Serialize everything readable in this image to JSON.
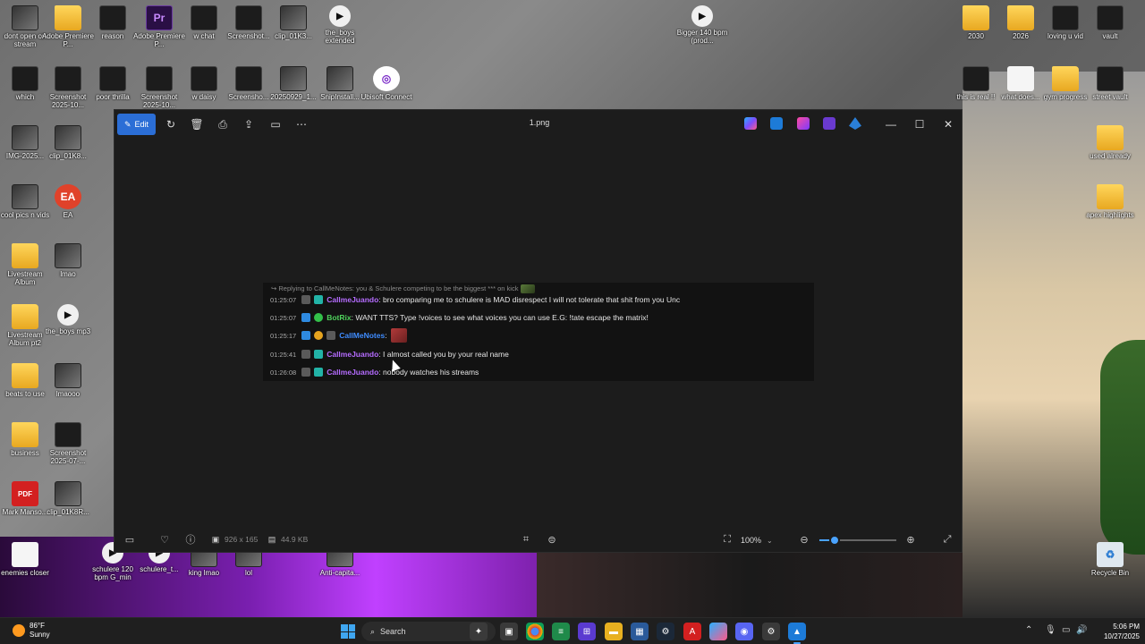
{
  "desktop": {
    "icons": [
      {
        "label": "dont open on stream",
        "type": "thumb",
        "glyph": ""
      },
      {
        "label": "Adobe Premiere P...",
        "type": "folder",
        "glyph": ""
      },
      {
        "label": "reason",
        "type": "dark",
        "glyph": ""
      },
      {
        "label": "Adobe Premiere P...",
        "type": "purple",
        "glyph": "Pr"
      },
      {
        "label": "w chat",
        "type": "dark",
        "glyph": ""
      },
      {
        "label": "Screenshot...",
        "type": "dark",
        "glyph": ""
      },
      {
        "label": "clip_01K3...",
        "type": "thumb",
        "glyph": ""
      },
      {
        "label": "the_boys extended",
        "type": "video",
        "glyph": "▶"
      },
      {
        "label": "Bigger 140 bpm (prod...",
        "type": "video",
        "glyph": "▶"
      },
      {
        "label": "2030",
        "type": "folder",
        "glyph": ""
      },
      {
        "label": "2026",
        "type": "folder",
        "glyph": ""
      },
      {
        "label": "loving u vid",
        "type": "dark",
        "glyph": ""
      },
      {
        "label": "vault",
        "type": "dark",
        "glyph": ""
      },
      {
        "label": "which",
        "type": "dark",
        "glyph": ""
      },
      {
        "label": "Screenshot 2025-10...",
        "type": "dark",
        "glyph": ""
      },
      {
        "label": "poor thrilla",
        "type": "dark",
        "glyph": ""
      },
      {
        "label": "Screenshot 2025-10...",
        "type": "dark",
        "glyph": ""
      },
      {
        "label": "w daisy",
        "type": "dark",
        "glyph": ""
      },
      {
        "label": "Screensho...",
        "type": "dark",
        "glyph": ""
      },
      {
        "label": "20250929_1...",
        "type": "thumb",
        "glyph": ""
      },
      {
        "label": "SnipInstall...",
        "type": "thumb",
        "glyph": ""
      },
      {
        "label": "Ubisoft Connect",
        "type": "ubi",
        "glyph": "◎"
      },
      {
        "label": "this is real !!",
        "type": "dark",
        "glyph": ""
      },
      {
        "label": "what does...",
        "type": "doc",
        "glyph": ""
      },
      {
        "label": "gym progress",
        "type": "folder",
        "glyph": ""
      },
      {
        "label": "street vault",
        "type": "dark",
        "glyph": ""
      },
      {
        "label": "IMG-2025...",
        "type": "thumb",
        "glyph": ""
      },
      {
        "label": "clip_01K8...",
        "type": "thumb",
        "glyph": ""
      },
      {
        "label": "used already",
        "type": "folder",
        "glyph": ""
      },
      {
        "label": "cool pics n vids",
        "type": "thumb",
        "glyph": ""
      },
      {
        "label": "EA",
        "type": "ea",
        "glyph": "EA"
      },
      {
        "label": "apex highlights",
        "type": "folder",
        "glyph": ""
      },
      {
        "label": "Livestream Album",
        "type": "folder",
        "glyph": ""
      },
      {
        "label": "lmao",
        "type": "thumb",
        "glyph": ""
      },
      {
        "label": "Livestream Album pt2",
        "type": "folder",
        "glyph": ""
      },
      {
        "label": "the_boys mp3",
        "type": "video",
        "glyph": "▶"
      },
      {
        "label": "beats to use",
        "type": "folder",
        "glyph": ""
      },
      {
        "label": "lmaooo",
        "type": "thumb",
        "glyph": ""
      },
      {
        "label": "business",
        "type": "folder",
        "glyph": ""
      },
      {
        "label": "Screenshot 2025-07-...",
        "type": "dark",
        "glyph": ""
      },
      {
        "label": "Mark Manso...",
        "type": "pdf",
        "glyph": "PDF"
      },
      {
        "label": "clip_01K8R...",
        "type": "thumb",
        "glyph": ""
      },
      {
        "label": "enemies closer",
        "type": "doc",
        "glyph": ""
      },
      {
        "label": "schulere 120 bpm G_min",
        "type": "video",
        "glyph": "▶"
      },
      {
        "label": "schulere_t...",
        "type": "video",
        "glyph": "▶"
      },
      {
        "label": "king lmao",
        "type": "thumb",
        "glyph": ""
      },
      {
        "label": "lol",
        "type": "thumb",
        "glyph": ""
      },
      {
        "label": "Anti-capita...",
        "type": "thumb",
        "glyph": ""
      },
      {
        "label": "Recycle Bin",
        "type": "recycle",
        "glyph": "♻"
      }
    ]
  },
  "photos_window": {
    "edit_label": "Edit",
    "title": "1.png",
    "bottom": {
      "dimensions": "926 x 165",
      "file_size": "44.9 KB",
      "zoom": "100%",
      "zoom_slider_fraction": 0.2
    }
  },
  "chat": {
    "reply_line": "Replying to CallMeNotes: you & Schulere competing to be the biggest *** on kick",
    "messages": [
      {
        "time": "01:25:07",
        "user": "CallmeJuando",
        "user_color": "purple",
        "badges": [
          "gift",
          "sub"
        ],
        "text": ": bro comparing me to schulere is MAD disrespect I will not tolerate that shit from you Unc"
      },
      {
        "time": "01:25:07",
        "user": "BotRix",
        "user_color": "green",
        "badges": [
          "bot",
          "green"
        ],
        "text": ": WANT TTS? Type !voices to see what voices you can use E.G: !tate escape the matrix!"
      },
      {
        "time": "01:25:17",
        "user": "CallMeNotes",
        "user_color": "blue",
        "badges": [
          "bot",
          "gold",
          "gift"
        ],
        "text": ":"
      },
      {
        "time": "01:25:41",
        "user": "CallmeJuando",
        "user_color": "purple",
        "badges": [
          "gift",
          "sub"
        ],
        "text": ": I almost called you by your real name"
      },
      {
        "time": "01:26:08",
        "user": "CallmeJuando",
        "user_color": "purple",
        "badges": [
          "gift",
          "sub"
        ],
        "text": ": nobody watches his streams"
      }
    ]
  },
  "taskbar": {
    "weather_temp": "86°F",
    "weather_desc": "Sunny",
    "search_placeholder": "Search",
    "time": "5:06 PM",
    "date": "10/27/2025"
  }
}
